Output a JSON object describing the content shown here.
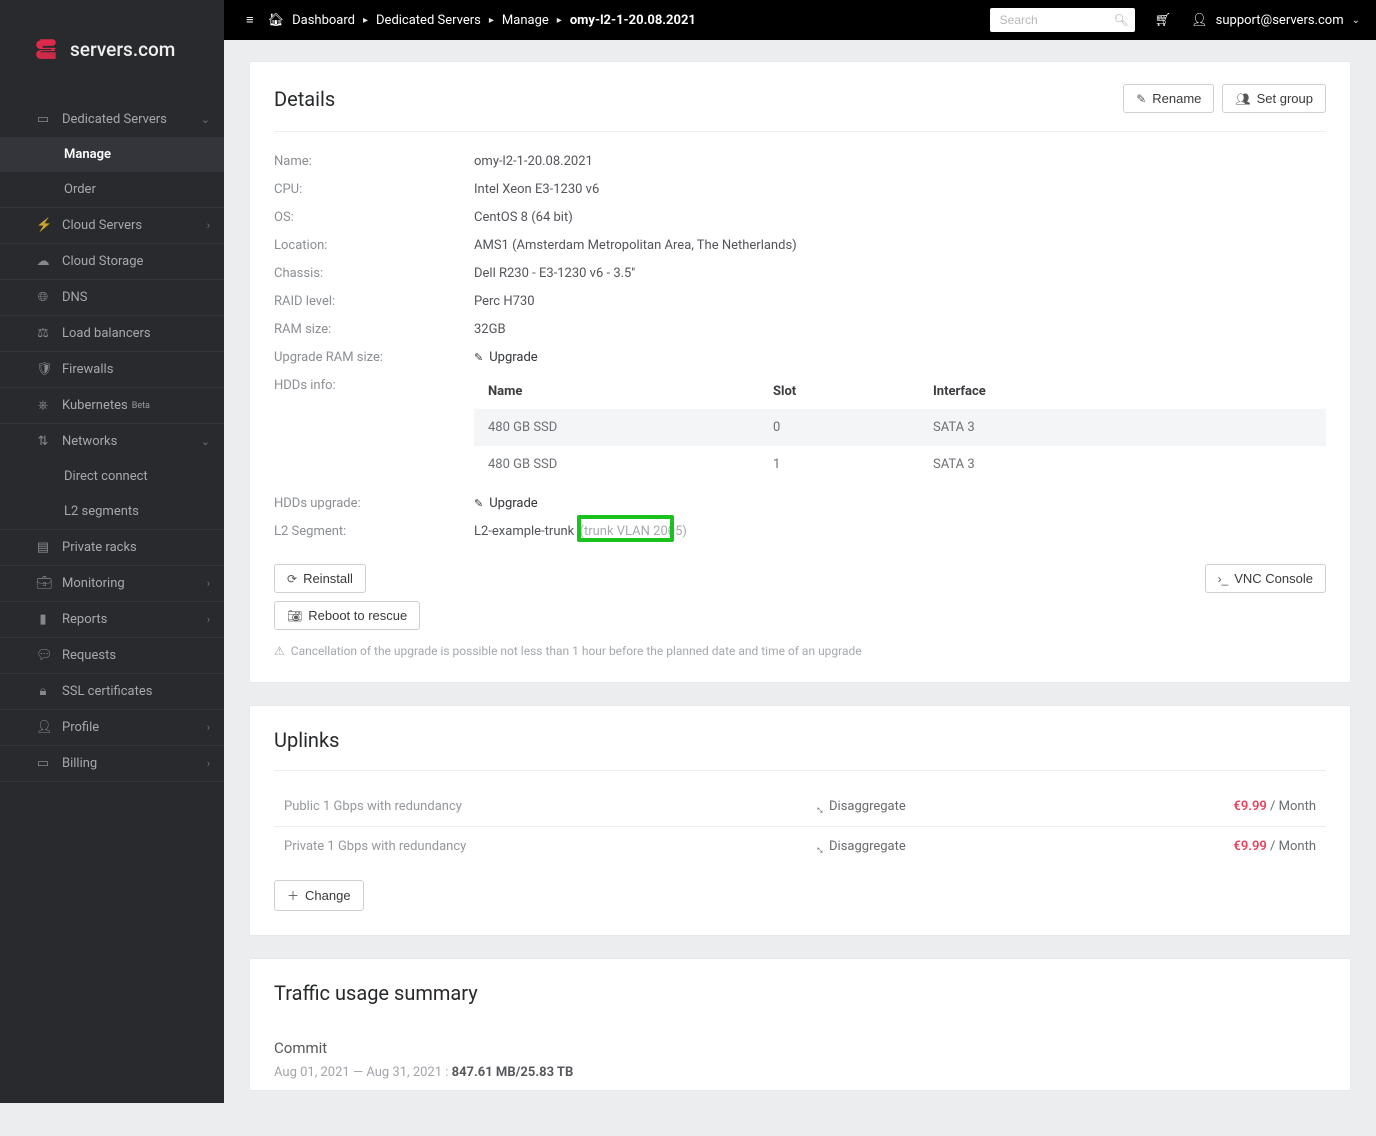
{
  "brand": {
    "text": "servers.com"
  },
  "sidebar": {
    "expanded": [
      "Dedicated Servers"
    ],
    "active": "Manage",
    "items": [
      {
        "label": "Dedicated Servers",
        "icon": "server-icon",
        "expandable": true,
        "children": [
          {
            "label": "Manage"
          },
          {
            "label": "Order"
          }
        ]
      },
      {
        "label": "Cloud Servers",
        "icon": "bolt-icon",
        "expandable": true
      },
      {
        "label": "Cloud Storage",
        "icon": "cloud-icon"
      },
      {
        "label": "DNS",
        "icon": "globe-icon"
      },
      {
        "label": "Load balancers",
        "icon": "balance-icon"
      },
      {
        "label": "Firewalls",
        "icon": "shield-icon"
      },
      {
        "label": "Kubernetes",
        "icon": "kube-icon",
        "badge": "Beta"
      },
      {
        "label": "Networks",
        "icon": "network-icon",
        "expandable": true,
        "children": [
          {
            "label": "Direct connect"
          },
          {
            "label": "L2 segments"
          }
        ]
      },
      {
        "label": "Private racks",
        "icon": "rack-icon"
      },
      {
        "label": "Monitoring",
        "icon": "case-icon",
        "expandable": true
      },
      {
        "label": "Reports",
        "icon": "file-icon",
        "expandable": true
      },
      {
        "label": "Requests",
        "icon": "chat-icon"
      },
      {
        "label": "SSL certificates",
        "icon": "lock-icon"
      },
      {
        "label": "Profile",
        "icon": "user-icon",
        "expandable": true
      },
      {
        "label": "Billing",
        "icon": "card-icon",
        "expandable": true
      }
    ]
  },
  "topbar": {
    "breadcrumbs": [
      {
        "label": "Dashboard"
      },
      {
        "label": "Dedicated Servers"
      },
      {
        "label": "Manage"
      },
      {
        "label": "omy-l2-1-20.08.2021",
        "current": true
      }
    ],
    "search_placeholder": "Search",
    "user": "support@servers.com"
  },
  "details": {
    "title": "Details",
    "btn_rename": "Rename",
    "btn_set_group": "Set group",
    "rows": {
      "name": {
        "label": "Name:",
        "value": "omy-l2-1-20.08.2021"
      },
      "cpu": {
        "label": "CPU:",
        "value": "Intel Xeon E3-1230 v6"
      },
      "os": {
        "label": "OS:",
        "value": "CentOS 8 (64 bit)"
      },
      "location": {
        "label": "Location:",
        "value": "AMS1 (Amsterdam Metropolitan Area, The Netherlands)"
      },
      "chassis": {
        "label": "Chassis:",
        "value": "Dell R230 - E3-1230 v6 - 3.5''"
      },
      "raid": {
        "label": "RAID level:",
        "value": "Perc H730"
      },
      "ram": {
        "label": "RAM size:",
        "value": "32GB"
      },
      "ram_upgrade": {
        "label": "Upgrade RAM size:",
        "value": "Upgrade"
      },
      "hdds_info": {
        "label": "HDDs info:"
      },
      "hdds_upgrade": {
        "label": "HDDs upgrade:",
        "value": "Upgrade"
      },
      "l2": {
        "label": "L2 Segment:",
        "base": "L2-example-trunk",
        "suffix": "(trunk VLAN 2005)"
      }
    },
    "hdd_table": {
      "cols": {
        "name": "Name",
        "slot": "Slot",
        "interface": "Interface"
      },
      "rows": [
        {
          "name": "480 GB SSD",
          "slot": "0",
          "interface": "SATA 3"
        },
        {
          "name": "480 GB SSD",
          "slot": "1",
          "interface": "SATA 3"
        }
      ]
    },
    "btn_reinstall": "Reinstall",
    "btn_vnc": "VNC Console",
    "btn_rescue": "Reboot to rescue",
    "cancellation_note": "Cancellation of the upgrade is possible not less than 1 hour before the planned date and time of an upgrade"
  },
  "uplinks": {
    "title": "Uplinks",
    "disaggregate": "Disaggregate",
    "rows": [
      {
        "name": "Public 1 Gbps with redundancy",
        "price": "€9.99",
        "per": "/ Month"
      },
      {
        "name": "Private 1 Gbps with redundancy",
        "price": "€9.99",
        "per": "/ Month"
      }
    ],
    "btn_change": "Change"
  },
  "traffic": {
    "title": "Traffic usage summary",
    "commit_label": "Commit",
    "range_pre": "Aug 01, 2021 — Aug 31, 2021 : ",
    "value": "847.61 MB/25.83 TB"
  },
  "colors": {
    "accent": "#dd2a4b",
    "price": "#e84159",
    "highlight": "#19c21d"
  }
}
